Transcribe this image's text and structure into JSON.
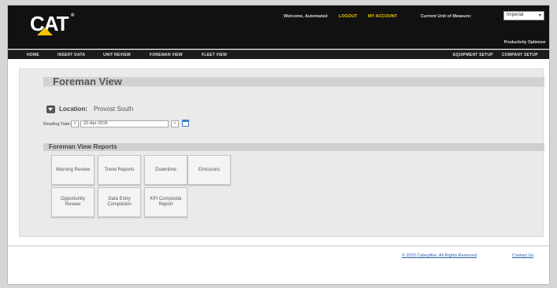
{
  "header": {
    "logo_text": "CAT",
    "logo_mark": "®",
    "welcome": "Welcome, Automated",
    "logout": "LOGOUT",
    "my_account": "MY ACCOUNT",
    "uom_label": "Current Unit of Measure:",
    "uom_value": "Imperial",
    "product_label": "Productivity Optimizer"
  },
  "nav": {
    "left": [
      "HOME",
      "INSERT DATA",
      "UNIT REVIEW",
      "FOREMAN VIEW",
      "FLEET VIEW"
    ],
    "right": [
      "EQUIPMENT SETUP",
      "COMPANY SETUP"
    ]
  },
  "page": {
    "title": "Foreman View",
    "location_label": "Location:",
    "location_value": "Provost South",
    "date_label": "Reading Date:",
    "date_prev": "<",
    "date_value": "22-Apr-2015",
    "date_next": ">",
    "reports_title": "Foreman View Reports"
  },
  "reports": [
    "Warning Review",
    "Trend Reports",
    "Downtime",
    "Emissions",
    "Opportunity Review",
    "Data Entry Completion",
    "KPI Composite Report"
  ],
  "footer": {
    "copyright": "© 2015 Caterpillar. All Rights Reserved",
    "contact": "Contact Us"
  },
  "colors": {
    "header_bg": "#111111",
    "accent_yellow": "#f5c400",
    "link_blue": "#2b5fa8"
  }
}
